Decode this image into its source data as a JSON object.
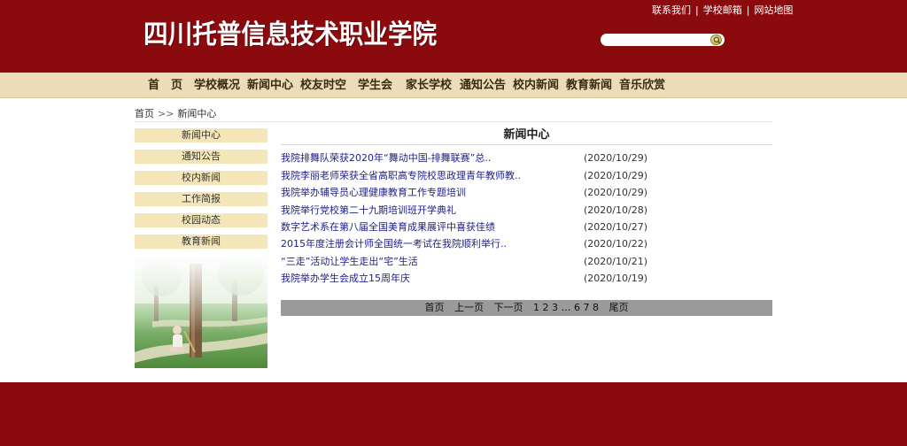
{
  "header": {
    "logo_text": "四川托普信息技术职业学院",
    "links": [
      "联系我们",
      "学校邮箱",
      "网站地图"
    ],
    "search_placeholder": ""
  },
  "nav": {
    "items": [
      "首　页",
      "学校概况",
      "新闻中心",
      "校友时空",
      "学生会",
      "家长学校",
      "通知公告",
      "校内新闻",
      "教育新闻",
      "音乐欣赏"
    ]
  },
  "breadcrumb": {
    "home": "首页",
    "separator": ">>",
    "current": "新闻中心"
  },
  "sidebar": {
    "items": [
      "新闻中心",
      "通知公告",
      "校内新闻",
      "工作简报",
      "校园动态",
      "教育新闻"
    ]
  },
  "content": {
    "title": "新闻中心",
    "news": [
      {
        "title": "我院排舞队荣获2020年“舞动中国-排舞联赛”总..",
        "date": "(2020/10/29)"
      },
      {
        "title": "我院李丽老师荣获全省高职高专院校思政理青年教师教..",
        "date": "(2020/10/29)"
      },
      {
        "title": "我院举办辅导员心理健康教育工作专题培训",
        "date": "(2020/10/29)"
      },
      {
        "title": "我院举行党校第二十九期培训班开学典礼",
        "date": "(2020/10/28)"
      },
      {
        "title": "数字艺术系在第八届全国美育成果展评中喜获佳绩",
        "date": "(2020/10/27)"
      },
      {
        "title": "2015年度注册会计师全国统一考试在我院顺利举行..",
        "date": "(2020/10/22)"
      },
      {
        "title": "“三走”活动让学生走出“宅”生活",
        "date": "(2020/10/21)"
      },
      {
        "title": "我院举办学生会成立15周年庆",
        "date": "(2020/10/19)"
      }
    ]
  },
  "pager": {
    "first": "首页",
    "prev": "上一页",
    "next": "下一页",
    "pages": "1 2 3 … 6 7 8",
    "last": "尾页"
  },
  "colors": {
    "brand": "#8b0a0e",
    "nav_bg": "#eddcb8",
    "side_bg": "#f4e6b8",
    "link": "#1d1d8a",
    "pager_bg": "#9a9a9a"
  }
}
